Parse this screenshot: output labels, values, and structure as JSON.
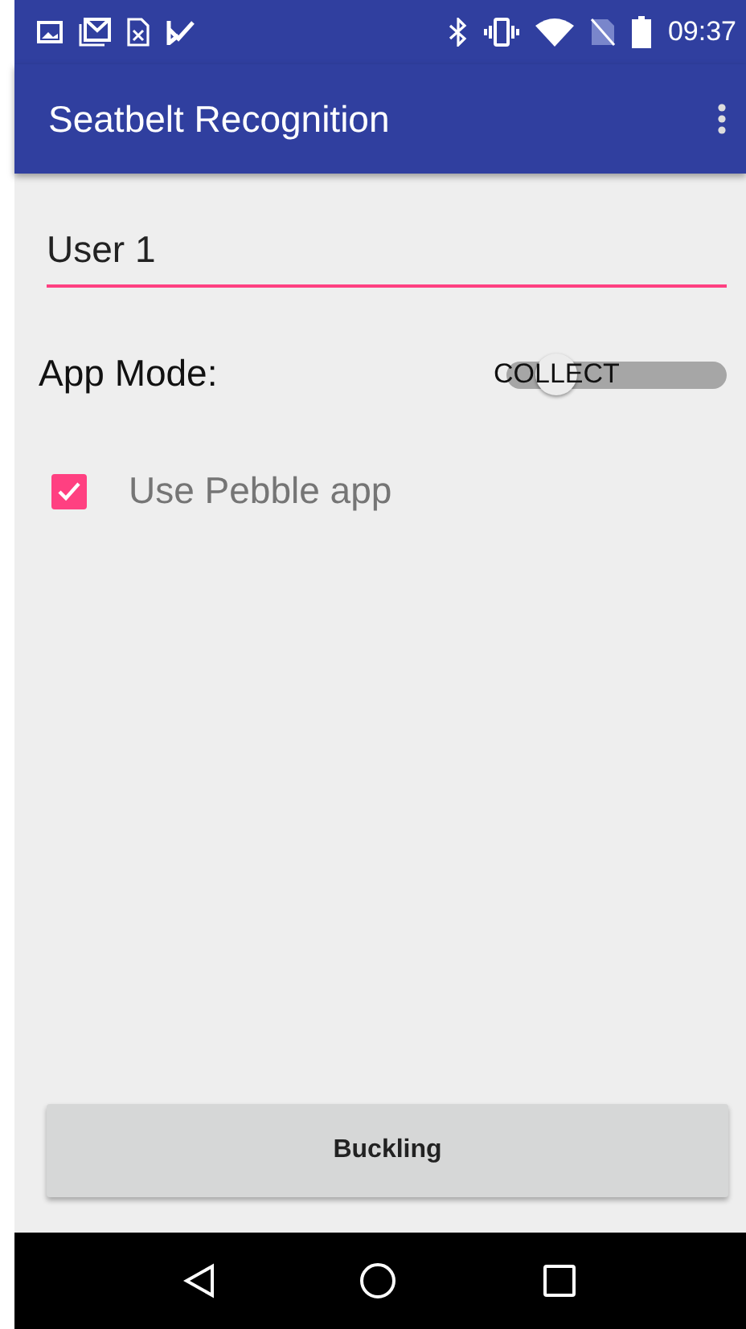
{
  "status_bar": {
    "time": "09:37"
  },
  "app_bar": {
    "title": "Seatbelt Recognition"
  },
  "name_field": {
    "value": "User 1"
  },
  "app_mode": {
    "label": "App Mode:",
    "switch_text": "COLLECT",
    "on": false
  },
  "pebble": {
    "label": "Use Pebble app",
    "checked": true
  },
  "buttons": [
    "Buckling"
  ]
}
